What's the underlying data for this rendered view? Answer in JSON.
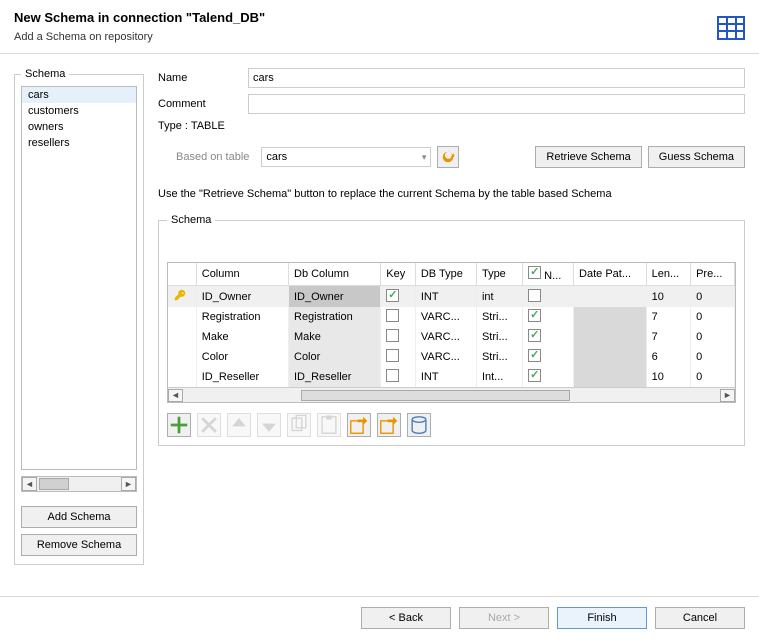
{
  "header": {
    "title": "New Schema in connection \"Talend_DB\"",
    "subtitle": "Add a Schema on repository"
  },
  "sidebar": {
    "legend": "Schema",
    "items": [
      "cars",
      "customers",
      "owners",
      "resellers"
    ],
    "selected": 0,
    "add_label": "Add Schema",
    "remove_label": "Remove Schema"
  },
  "form": {
    "name_label": "Name",
    "name_value": "cars",
    "comment_label": "Comment",
    "comment_value": "",
    "type_label": "Type : TABLE",
    "based_label": "Based on table",
    "based_value": "cars",
    "retrieve_label": "Retrieve Schema",
    "guess_label": "Guess Schema",
    "hint": "Use the \"Retrieve Schema\" button to replace the current Schema by the table based Schema"
  },
  "schema_table": {
    "legend": "Schema",
    "headers": {
      "column": "Column",
      "db": "Db Column",
      "key": "Key",
      "dbtype": "DB Type",
      "type": "Type",
      "n_check": true,
      "n": "N...",
      "date": "Date Pat...",
      "len": "Len...",
      "pre": "Pre..."
    },
    "rows": [
      {
        "column": "ID_Owner",
        "db": "ID_Owner",
        "key": true,
        "dbtype": "INT",
        "type": "int",
        "n": false,
        "len": "10",
        "pre": "0"
      },
      {
        "column": "Registration",
        "db": "Registration",
        "key": false,
        "dbtype": "VARC...",
        "type": "Stri...",
        "n": true,
        "len": "7",
        "pre": "0"
      },
      {
        "column": "Make",
        "db": "Make",
        "key": false,
        "dbtype": "VARC...",
        "type": "Stri...",
        "n": true,
        "len": "7",
        "pre": "0"
      },
      {
        "column": "Color",
        "db": "Color",
        "key": false,
        "dbtype": "VARC...",
        "type": "Stri...",
        "n": true,
        "len": "6",
        "pre": "0"
      },
      {
        "column": "ID_Reseller",
        "db": "ID_Reseller",
        "key": false,
        "dbtype": "INT",
        "type": "Int...",
        "n": true,
        "len": "10",
        "pre": "0"
      }
    ],
    "selected": 0
  },
  "toolbar": {
    "add": "plus-icon",
    "remove": "cross-icon",
    "up": "arrow-up-icon",
    "down": "arrow-down-icon",
    "copy": "copy-icon",
    "paste": "paste-icon",
    "import": "import-icon",
    "export": "export-icon",
    "default": "reset-icon"
  },
  "footer": {
    "back": "< Back",
    "next": "Next >",
    "finish": "Finish",
    "cancel": "Cancel"
  }
}
